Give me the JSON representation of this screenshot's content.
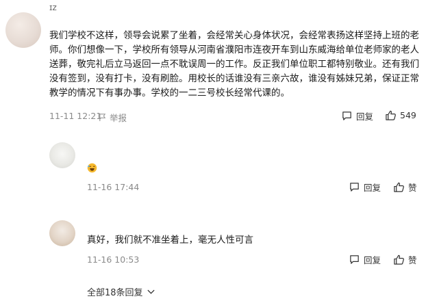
{
  "comment": {
    "username": "ɪz",
    "text": "我们学校不这样，领导会说累了坐着，会经常关心身体状况，会经常表扬这样坚持上班的老师。你们想像一下，学校所有领导从河南省濮阳市连夜开车到山东威海给单位老师家的老人送葬，敬完礼后立马返回一点不耽误周一的工作。反正我们单位职工都特别敬业。还有我们没有签到，没有打卡，没有刷脸。用校长的话谁没有三亲六故，谁没有姊妹兄弟，保证正常教学的情况下有事办事。学校的一二三号校长经常代课的。",
    "timestamp": "11-11 12:21",
    "report_label": "举报",
    "reply_label": "回复",
    "like_count": "549"
  },
  "replies": [
    {
      "username": "",
      "text": "",
      "timestamp": "11-16 17:44",
      "reply_label": "回复",
      "like_label": "赞"
    },
    {
      "username": "",
      "text": "真好，我们就不准坐着上，毫无人性可言",
      "timestamp": "11-16 10:53",
      "reply_label": "回复",
      "like_label": "赞"
    }
  ],
  "more_replies": {
    "label": "全部18条回复"
  },
  "icons": {
    "reply": "comment-bubble-icon",
    "like": "thumbs-up-icon",
    "report": "flag-icon",
    "emoji": "laughing-emoji-icon",
    "expand": "chevron-down-icon"
  },
  "colors": {
    "meta": "#8a8a8a",
    "text": "#1a1a1a",
    "emoji": "#f5b82e"
  }
}
